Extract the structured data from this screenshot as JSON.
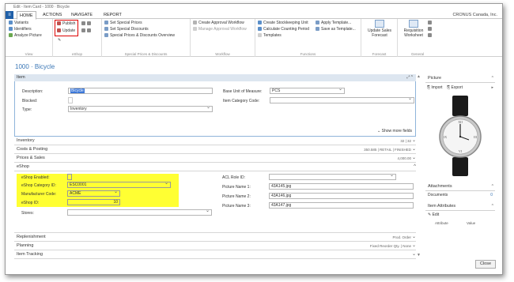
{
  "window_title": "Edit - Item Card - 1000 · Bicycle",
  "menu": {
    "logo": "≡",
    "tabs": [
      "HOME",
      "ACTIONS",
      "NAVIGATE",
      "REPORT"
    ],
    "active": "HOME",
    "company": "CRONUS Canada, Inc."
  },
  "ribbon": {
    "view": {
      "items": [
        "Variants",
        "Identifiers",
        "Analyze Picture"
      ],
      "label": "View"
    },
    "eshop": {
      "publish": "Publish",
      "update": "Update",
      "label": "eShop"
    },
    "prices": {
      "items": [
        "Set Special Prices",
        "Set Special Discounts",
        "Special Prices & Discounts Overview"
      ],
      "label": "Special Prices & Discounts"
    },
    "workflow": {
      "items": [
        "Create Approval Workflow",
        "Manage Approval Workflow"
      ],
      "label": "Workflow"
    },
    "functions": {
      "items": [
        "Create Stockkeeping Unit",
        "Calculate Counting Period",
        "Templates",
        "Apply Template...",
        "Save as Template..."
      ],
      "label": "Functions"
    },
    "forecast": {
      "btn": "Update Sales Forecast",
      "label": "Forecast"
    },
    "general": {
      "btn": "Requisition Worksheet",
      "label": "General"
    }
  },
  "page_title": "1000 · Bicycle",
  "item": {
    "header": "Item",
    "description_label": "Description:",
    "description": "Bicycle",
    "blocked_label": "Blocked:",
    "type_label": "Type:",
    "type": "Inventory",
    "base_uom_label": "Base Unit of Measure:",
    "base_uom": "PCS",
    "category_label": "Item Category Code:",
    "category": "",
    "show_more": "Show more fields"
  },
  "fasttabs": [
    {
      "label": "Inventory",
      "vals": "32   |   32"
    },
    {
      "label": "Costs & Posting",
      "vals": "350.585   |   RETAIL   |   FINISHED"
    },
    {
      "label": "Prices & Sales",
      "vals": "4,000.00"
    }
  ],
  "eshop": {
    "header": "eShop",
    "enabled_label": "eShop Enabled:",
    "category_label": "eShop Category ID:",
    "category": "ESC0001",
    "manufacturer_label": "Manufacturer Code:",
    "manufacturer": "ACME",
    "id_label": "eShop ID:",
    "id": "10",
    "stores_label": "Stores:",
    "acl_label": "ACL Role ID:",
    "pic1_label": "Picture Name 1:",
    "pic1": "43A145.jpg",
    "pic2_label": "Picture Name 2:",
    "pic2": "43A146.jpg",
    "pic3_label": "Picture Name 3:",
    "pic3": "43A147.jpg"
  },
  "fasttabs2": [
    {
      "label": "Replenishment",
      "vals": "Prod. Order"
    },
    {
      "label": "Planning",
      "vals": "Fixed Reorder Qty.   |   None"
    },
    {
      "label": "Item Tracking",
      "vals": ""
    }
  ],
  "factbox": {
    "picture": "Picture",
    "import": "Import",
    "export": "Export",
    "attachments": "Attachments",
    "documents": "Documents",
    "documents_count": "0",
    "attributes": "Item Attributes",
    "edit": "Edit",
    "col_attribute": "Attribute",
    "col_value": "Value"
  },
  "close": "Close",
  "colors": {
    "accent": "#3b77b6",
    "highlight": "#ffff33",
    "redbox": "#dd0000"
  }
}
